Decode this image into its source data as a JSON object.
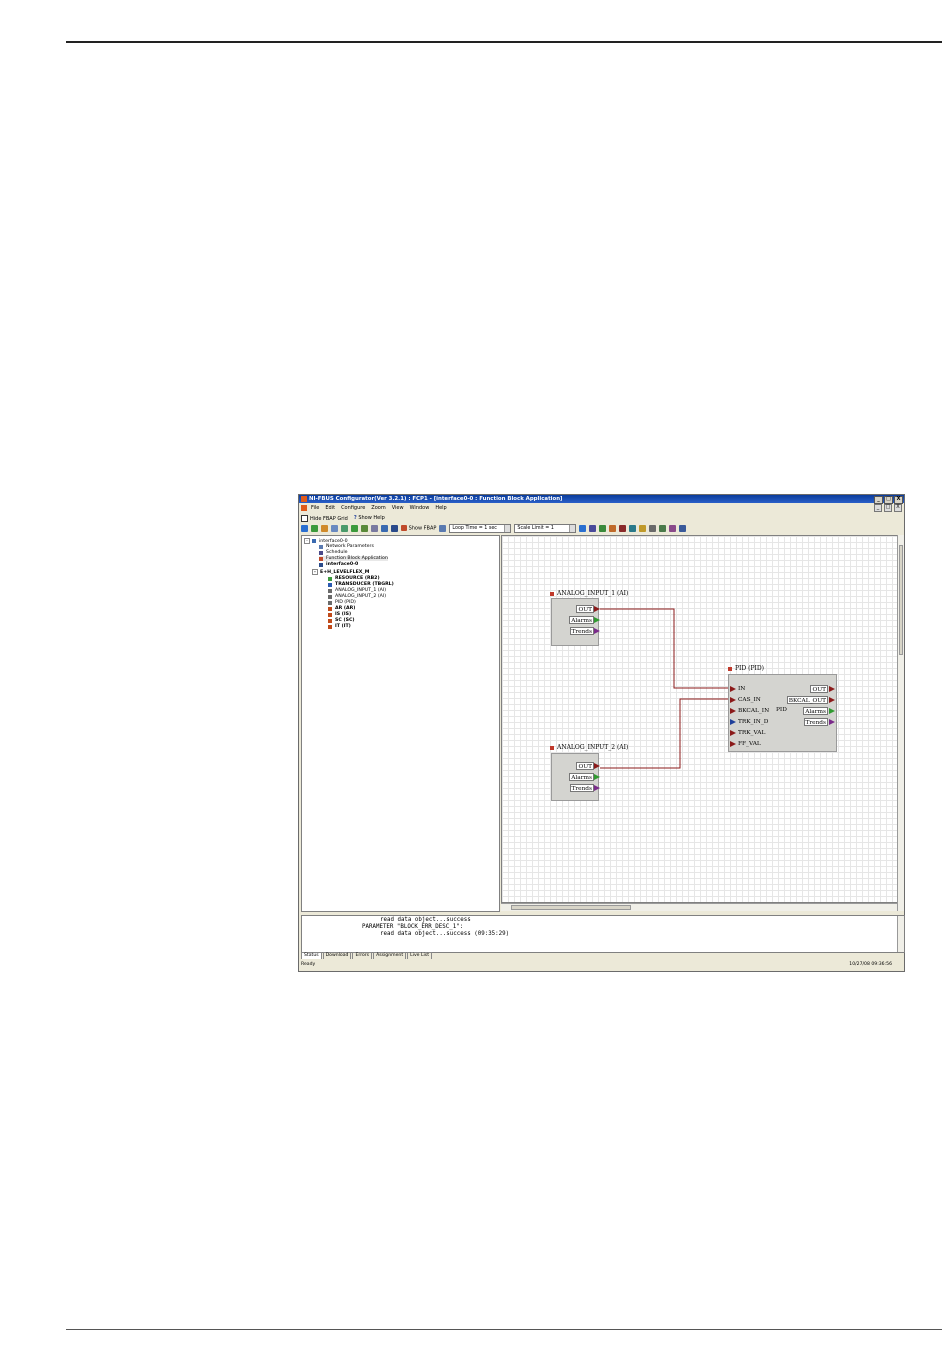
{
  "window": {
    "title": "NI-FBUS Configurator(Ver 3.2.1) : FCP1 - [interface0-0 : Function Block Application]",
    "controls": [
      "_",
      "□",
      "X"
    ],
    "mdi_controls": [
      "_",
      "□",
      "X"
    ]
  },
  "menu": [
    "File",
    "Edit",
    "Configure",
    "Zoom",
    "View",
    "Window",
    "Help"
  ],
  "toolbar1": {
    "hide_grid": "Hide FBAP Grid",
    "show_help": "Show Help"
  },
  "toolbar2": {
    "show_fbap": "Show FBAP",
    "loop_time": "Loop Time = 1 sec",
    "scale_limit": "Scale Limit = 1"
  },
  "tree": {
    "items": [
      {
        "label": "interface0-0"
      },
      {
        "label": "Network Parameters"
      },
      {
        "label": "Schedule"
      },
      {
        "label": "Function Block Application"
      },
      {
        "label": "interface0-0"
      },
      {
        "label": "E+H_LEVELFLEX_M"
      },
      {
        "label": "RESOURCE (RB2)"
      },
      {
        "label": "TRANSDUCER (TBGRL)"
      },
      {
        "label": "ANALOG_INPUT_1 (AI)"
      },
      {
        "label": "ANALOG_INPUT_2 (AI)"
      },
      {
        "label": "PID (PID)"
      },
      {
        "label": "AR (AR)"
      },
      {
        "label": "IS (IS)"
      },
      {
        "label": "SC (SC)"
      },
      {
        "label": "IT (IT)"
      }
    ]
  },
  "blocks": {
    "ai1": {
      "title": "ANALOG_INPUT_1 (AI)",
      "outputs": [
        "OUT",
        "Alarms",
        "Trends"
      ]
    },
    "ai2": {
      "title": "ANALOG_INPUT_2 (AI)",
      "outputs": [
        "OUT",
        "Alarms",
        "Trends"
      ]
    },
    "pid": {
      "title": "PID (PID)",
      "center": "PID",
      "inputs": [
        "IN",
        "CAS_IN",
        "BKCAL_IN",
        "TRK_IN_D",
        "TRK_VAL",
        "FF_VAL"
      ],
      "outputs": [
        "OUT",
        "BKCAL_OUT",
        "Alarms",
        "Trends"
      ]
    }
  },
  "log": {
    "lines": [
      "read data object...success",
      "PARAMETER \"BLOCK_ERR_DESC_1\":",
      "read data object...success (09:35:29)"
    ]
  },
  "tabs": [
    "Status",
    "Download",
    "Errors",
    "Assignment",
    "Live List"
  ],
  "status": {
    "left": "Ready",
    "right": "10/27/08 09:36:56"
  },
  "colors": {
    "title_bar": "#0a3c9c",
    "wire": "#8b1a1a",
    "port_red": "#8b1a1a",
    "port_green": "#2f9a2f",
    "port_purple": "#7a2a8a",
    "port_blue": "#1f3f9a"
  }
}
